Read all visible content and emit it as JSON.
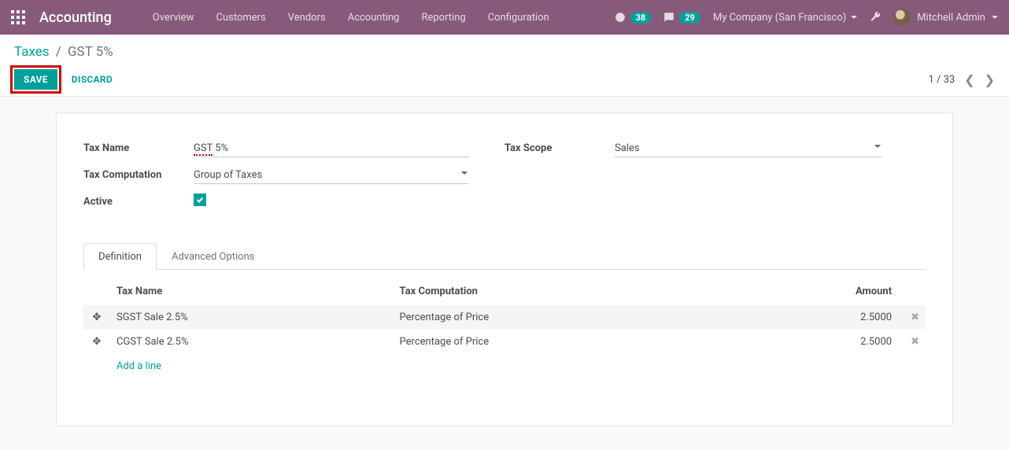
{
  "nav": {
    "brand": "Accounting",
    "menu": [
      "Overview",
      "Customers",
      "Vendors",
      "Accounting",
      "Reporting",
      "Configuration"
    ],
    "activity_count": "38",
    "discuss_count": "29",
    "company": "My Company (San Francisco)",
    "user": "Mitchell Admin"
  },
  "breadcrumb": {
    "root": "Taxes",
    "sep": "/",
    "current": "GST 5%"
  },
  "actions": {
    "save": "SAVE",
    "discard": "DISCARD",
    "pager": "1 / 33"
  },
  "form": {
    "labels": {
      "tax_name": "Tax Name",
      "tax_computation": "Tax Computation",
      "active": "Active",
      "tax_scope": "Tax Scope"
    },
    "values": {
      "tax_name_plain": "GST 5%",
      "tax_name_left": "GST",
      "tax_name_right": " 5%",
      "tax_computation": "Group of Taxes",
      "tax_scope": "Sales",
      "active": true
    }
  },
  "tabs": [
    "Definition",
    "Advanced Options"
  ],
  "table": {
    "headers": {
      "name": "Tax Name",
      "computation": "Tax Computation",
      "amount": "Amount"
    },
    "rows": [
      {
        "name": "SGST Sale 2.5%",
        "computation": "Percentage of Price",
        "amount": "2.5000"
      },
      {
        "name": "CGST Sale 2.5%",
        "computation": "Percentage of Price",
        "amount": "2.5000"
      }
    ],
    "add_line": "Add a line"
  }
}
